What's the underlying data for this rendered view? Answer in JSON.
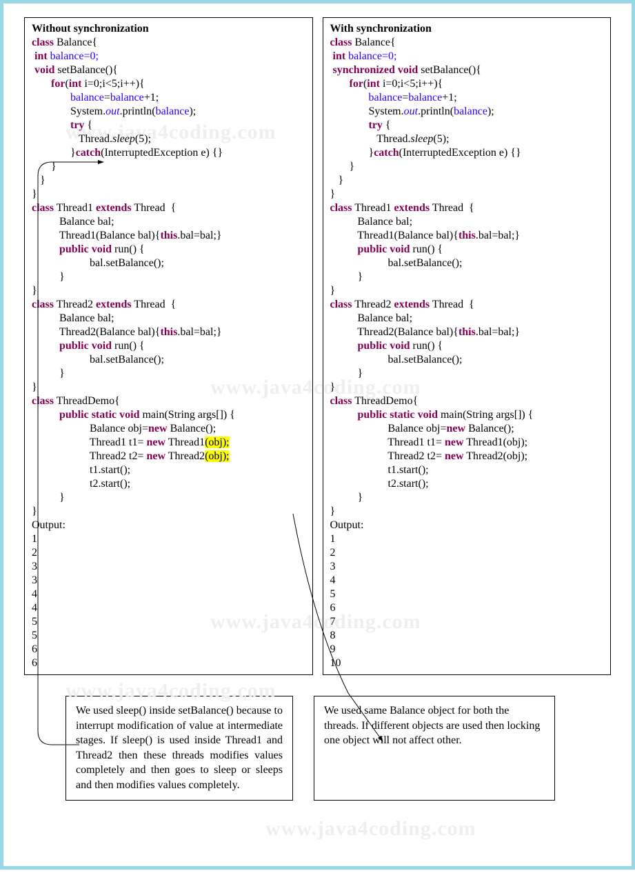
{
  "left": {
    "title": "Without synchronization",
    "output_label": "Output:",
    "output": [
      "1",
      "2",
      "3",
      "3",
      "4",
      "4",
      "5",
      "5",
      "6",
      "6"
    ]
  },
  "right": {
    "title": "With synchronization",
    "output_label": "Output:",
    "output": [
      "1",
      "2",
      "3",
      "4",
      "5",
      "6",
      "7",
      "8",
      "9",
      "10"
    ]
  },
  "code_tokens": {
    "class": "class",
    "int": "int",
    "void": "void",
    "synchronized_void": "synchronized void",
    "for": "for",
    "try": "try",
    "catch": "catch",
    "extends": "extends",
    "this": "this",
    "public_void": "public void",
    "public_static_void": "public static void",
    "new": "new",
    "Balance": " Balance{",
    "balance_decl": "balance=0;",
    "setBalance_sig": " setBalance(){",
    "for_head": " i=0;i<5;i++){",
    "balance_assign_a": "balance",
    "balance_assign_b": "=",
    "balance_assign_c": "balance",
    "balance_assign_d": "+1;",
    "println_a": "System.",
    "println_b": "out",
    "println_c": ".println(",
    "println_d": "balance",
    "println_e": ");",
    "try_open": " {",
    "sleep_a": "Thread.",
    "sleep_b": "sleep",
    "sleep_c": "(5);",
    "catch_head": "(InterruptedException e) {}",
    "Thread1_h": " Thread1 ",
    "Thread2_h": " Thread2 ",
    "Thread_tail": " Thread  {",
    "bal_decl": "Balance bal;",
    "t1_ctor_a": "Thread1(Balance bal){",
    "t2_ctor_a": "Thread2(Balance bal){",
    "ctor_b": ".bal=bal;}",
    "run_sig": " run() {",
    "bal_call": "bal.setBalance();",
    "ThreadDemo_h": " ThreadDemo{",
    "main_sig": " main(String args[]) {",
    "obj_line_a": "Balance obj=",
    "obj_line_b": " Balance();",
    "t1_line_a": "Thread1 t1= ",
    "t1_line_b": " Thread1",
    "t1_line_c": "(obj);",
    "t2_line_a": "Thread2 t2= ",
    "t2_line_b": " Thread2",
    "t2_line_c": "(obj);",
    "t1_start": "t1.start();",
    "t2_start": "t2.start();",
    "cb": "}"
  },
  "notes": {
    "left": "We used sleep() inside setBalance() because to interrupt modification of value at intermediate stages. If sleep() is used inside Thread1 and Thread2 then these threads modifies values completely and then goes to sleep or sleeps and then modifies values completely.",
    "right": "We used same Balance object for both the threads. If different objects are used then locking one object will not affect other."
  },
  "watermark": "www.java4coding.com"
}
